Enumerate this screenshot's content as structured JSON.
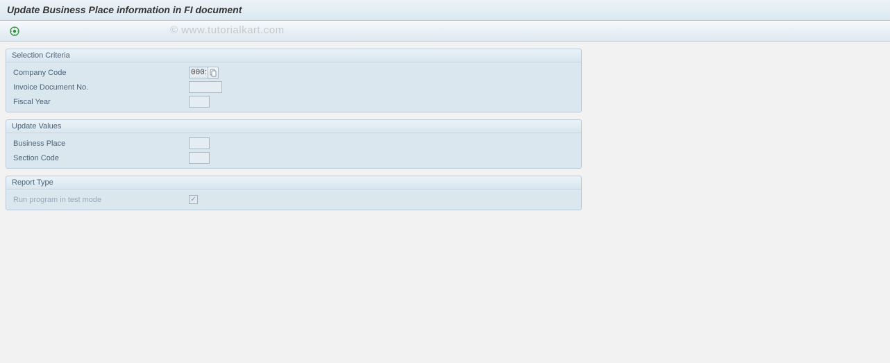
{
  "title": "Update Business Place information in FI document",
  "watermark": "© www.tutorialkart.com",
  "groups": {
    "selection": {
      "title": "Selection Criteria",
      "fields": {
        "company_code": {
          "label": "Company Code",
          "value": "0001"
        },
        "invoice_no": {
          "label": "Invoice Document No.",
          "value": ""
        },
        "fiscal_year": {
          "label": "Fiscal Year",
          "value": ""
        }
      }
    },
    "update": {
      "title": "Update Values",
      "fields": {
        "business_place": {
          "label": "Business Place",
          "value": ""
        },
        "section_code": {
          "label": "Section Code",
          "value": ""
        }
      }
    },
    "report": {
      "title": "Report Type",
      "fields": {
        "test_mode": {
          "label": "Run program in test mode",
          "checked": true
        }
      }
    }
  }
}
